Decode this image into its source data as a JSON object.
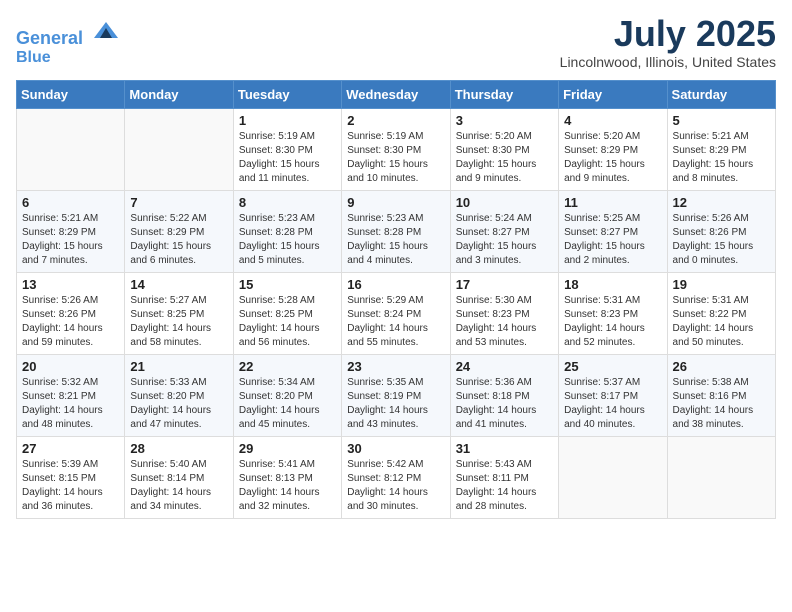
{
  "header": {
    "logo_line1": "General",
    "logo_line2": "Blue",
    "month_year": "July 2025",
    "location": "Lincolnwood, Illinois, United States"
  },
  "days_of_week": [
    "Sunday",
    "Monday",
    "Tuesday",
    "Wednesday",
    "Thursday",
    "Friday",
    "Saturday"
  ],
  "weeks": [
    [
      {
        "day": "",
        "info": ""
      },
      {
        "day": "",
        "info": ""
      },
      {
        "day": "1",
        "info": "Sunrise: 5:19 AM\nSunset: 8:30 PM\nDaylight: 15 hours and 11 minutes."
      },
      {
        "day": "2",
        "info": "Sunrise: 5:19 AM\nSunset: 8:30 PM\nDaylight: 15 hours and 10 minutes."
      },
      {
        "day": "3",
        "info": "Sunrise: 5:20 AM\nSunset: 8:30 PM\nDaylight: 15 hours and 9 minutes."
      },
      {
        "day": "4",
        "info": "Sunrise: 5:20 AM\nSunset: 8:29 PM\nDaylight: 15 hours and 9 minutes."
      },
      {
        "day": "5",
        "info": "Sunrise: 5:21 AM\nSunset: 8:29 PM\nDaylight: 15 hours and 8 minutes."
      }
    ],
    [
      {
        "day": "6",
        "info": "Sunrise: 5:21 AM\nSunset: 8:29 PM\nDaylight: 15 hours and 7 minutes."
      },
      {
        "day": "7",
        "info": "Sunrise: 5:22 AM\nSunset: 8:29 PM\nDaylight: 15 hours and 6 minutes."
      },
      {
        "day": "8",
        "info": "Sunrise: 5:23 AM\nSunset: 8:28 PM\nDaylight: 15 hours and 5 minutes."
      },
      {
        "day": "9",
        "info": "Sunrise: 5:23 AM\nSunset: 8:28 PM\nDaylight: 15 hours and 4 minutes."
      },
      {
        "day": "10",
        "info": "Sunrise: 5:24 AM\nSunset: 8:27 PM\nDaylight: 15 hours and 3 minutes."
      },
      {
        "day": "11",
        "info": "Sunrise: 5:25 AM\nSunset: 8:27 PM\nDaylight: 15 hours and 2 minutes."
      },
      {
        "day": "12",
        "info": "Sunrise: 5:26 AM\nSunset: 8:26 PM\nDaylight: 15 hours and 0 minutes."
      }
    ],
    [
      {
        "day": "13",
        "info": "Sunrise: 5:26 AM\nSunset: 8:26 PM\nDaylight: 14 hours and 59 minutes."
      },
      {
        "day": "14",
        "info": "Sunrise: 5:27 AM\nSunset: 8:25 PM\nDaylight: 14 hours and 58 minutes."
      },
      {
        "day": "15",
        "info": "Sunrise: 5:28 AM\nSunset: 8:25 PM\nDaylight: 14 hours and 56 minutes."
      },
      {
        "day": "16",
        "info": "Sunrise: 5:29 AM\nSunset: 8:24 PM\nDaylight: 14 hours and 55 minutes."
      },
      {
        "day": "17",
        "info": "Sunrise: 5:30 AM\nSunset: 8:23 PM\nDaylight: 14 hours and 53 minutes."
      },
      {
        "day": "18",
        "info": "Sunrise: 5:31 AM\nSunset: 8:23 PM\nDaylight: 14 hours and 52 minutes."
      },
      {
        "day": "19",
        "info": "Sunrise: 5:31 AM\nSunset: 8:22 PM\nDaylight: 14 hours and 50 minutes."
      }
    ],
    [
      {
        "day": "20",
        "info": "Sunrise: 5:32 AM\nSunset: 8:21 PM\nDaylight: 14 hours and 48 minutes."
      },
      {
        "day": "21",
        "info": "Sunrise: 5:33 AM\nSunset: 8:20 PM\nDaylight: 14 hours and 47 minutes."
      },
      {
        "day": "22",
        "info": "Sunrise: 5:34 AM\nSunset: 8:20 PM\nDaylight: 14 hours and 45 minutes."
      },
      {
        "day": "23",
        "info": "Sunrise: 5:35 AM\nSunset: 8:19 PM\nDaylight: 14 hours and 43 minutes."
      },
      {
        "day": "24",
        "info": "Sunrise: 5:36 AM\nSunset: 8:18 PM\nDaylight: 14 hours and 41 minutes."
      },
      {
        "day": "25",
        "info": "Sunrise: 5:37 AM\nSunset: 8:17 PM\nDaylight: 14 hours and 40 minutes."
      },
      {
        "day": "26",
        "info": "Sunrise: 5:38 AM\nSunset: 8:16 PM\nDaylight: 14 hours and 38 minutes."
      }
    ],
    [
      {
        "day": "27",
        "info": "Sunrise: 5:39 AM\nSunset: 8:15 PM\nDaylight: 14 hours and 36 minutes."
      },
      {
        "day": "28",
        "info": "Sunrise: 5:40 AM\nSunset: 8:14 PM\nDaylight: 14 hours and 34 minutes."
      },
      {
        "day": "29",
        "info": "Sunrise: 5:41 AM\nSunset: 8:13 PM\nDaylight: 14 hours and 32 minutes."
      },
      {
        "day": "30",
        "info": "Sunrise: 5:42 AM\nSunset: 8:12 PM\nDaylight: 14 hours and 30 minutes."
      },
      {
        "day": "31",
        "info": "Sunrise: 5:43 AM\nSunset: 8:11 PM\nDaylight: 14 hours and 28 minutes."
      },
      {
        "day": "",
        "info": ""
      },
      {
        "day": "",
        "info": ""
      }
    ]
  ]
}
